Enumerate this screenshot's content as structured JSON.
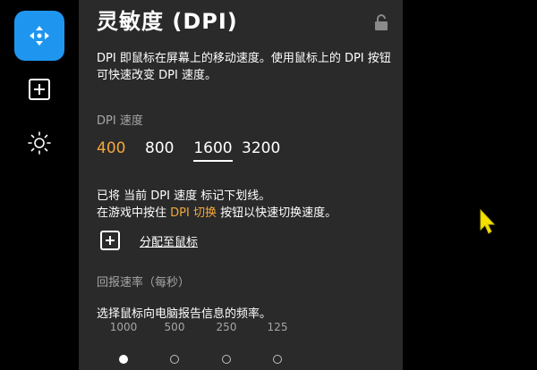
{
  "sidebar": {
    "items": [
      {
        "icon": "move-arrows-icon",
        "active": true
      },
      {
        "icon": "add-square-icon",
        "active": false
      },
      {
        "icon": "brightness-icon",
        "active": false
      }
    ]
  },
  "panel": {
    "title": "灵敏度 (DPI)",
    "lock_icon": "unlocked-padlock-icon",
    "description": "DPI 即鼠标在屏幕上的移动速度。使用鼠标上的 DPI 按钮可快速改变 DPI 速度。",
    "dpi_label": "DPI 速度",
    "dpi_values": [
      "400",
      "800",
      "1600",
      "3200"
    ],
    "active_dpi": "400",
    "current_dpi": "1600",
    "note_line1": "已将 当前 DPI 速度 标记下划线。",
    "note_line2_prefix": "在游戏中按住 ",
    "note_line2_highlight": "DPI 切换",
    "note_line2_suffix": " 按钮以快速切换速度。",
    "assign_label": "分配至鼠标",
    "rate_label": "回报速率（每秒）",
    "rate_description": "选择鼠标向电脑报告信息的频率。",
    "rate_options": [
      "1000",
      "500",
      "250",
      "125"
    ],
    "rate_selected": "1000"
  },
  "colors": {
    "accent_blue": "#1e96f0",
    "accent_orange": "#f4a83a",
    "panel_bg": "#2a2a2a",
    "cursor_yellow": "#f5e000"
  }
}
